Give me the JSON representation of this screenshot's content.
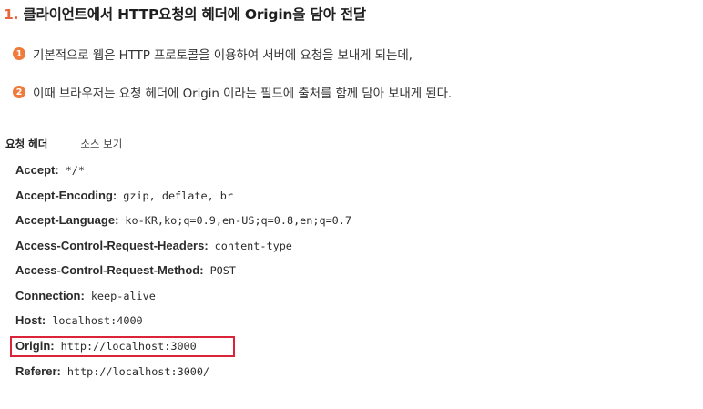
{
  "heading": {
    "number": "1.",
    "title": "클라이언트에서 HTTP요청의 헤더에 Origin을 담아 전달"
  },
  "bullets": [
    {
      "badge": "1",
      "text": "기본적으로 웹은 HTTP 프로토콜을 이용하여 서버에 요청을 보내게 되는데,"
    },
    {
      "badge": "2",
      "text": "이때 브라우저는 요청 헤더에 Origin 이라는 필드에 출처를 함께 담아 보내게 된다."
    }
  ],
  "request_headers_panel": {
    "tab_active": "요청 헤더",
    "tab_source": "소스 보기",
    "headers": [
      {
        "name": "Accept:",
        "value": "*/*"
      },
      {
        "name": "Accept-Encoding:",
        "value": "gzip, deflate, br"
      },
      {
        "name": "Accept-Language:",
        "value": "ko-KR,ko;q=0.9,en-US;q=0.8,en;q=0.7"
      },
      {
        "name": "Access-Control-Request-Headers:",
        "value": "content-type"
      },
      {
        "name": "Access-Control-Request-Method:",
        "value": "POST"
      },
      {
        "name": "Connection:",
        "value": "keep-alive"
      },
      {
        "name": "Host:",
        "value": "localhost:4000"
      },
      {
        "name": "Origin:",
        "value": "http://localhost:3000"
      },
      {
        "name": "Referer:",
        "value": "http://localhost:3000/"
      }
    ]
  },
  "colors": {
    "accent_orange": "#f07a3a",
    "heading_number": "#e8663d",
    "highlight_red": "#d9243a"
  }
}
